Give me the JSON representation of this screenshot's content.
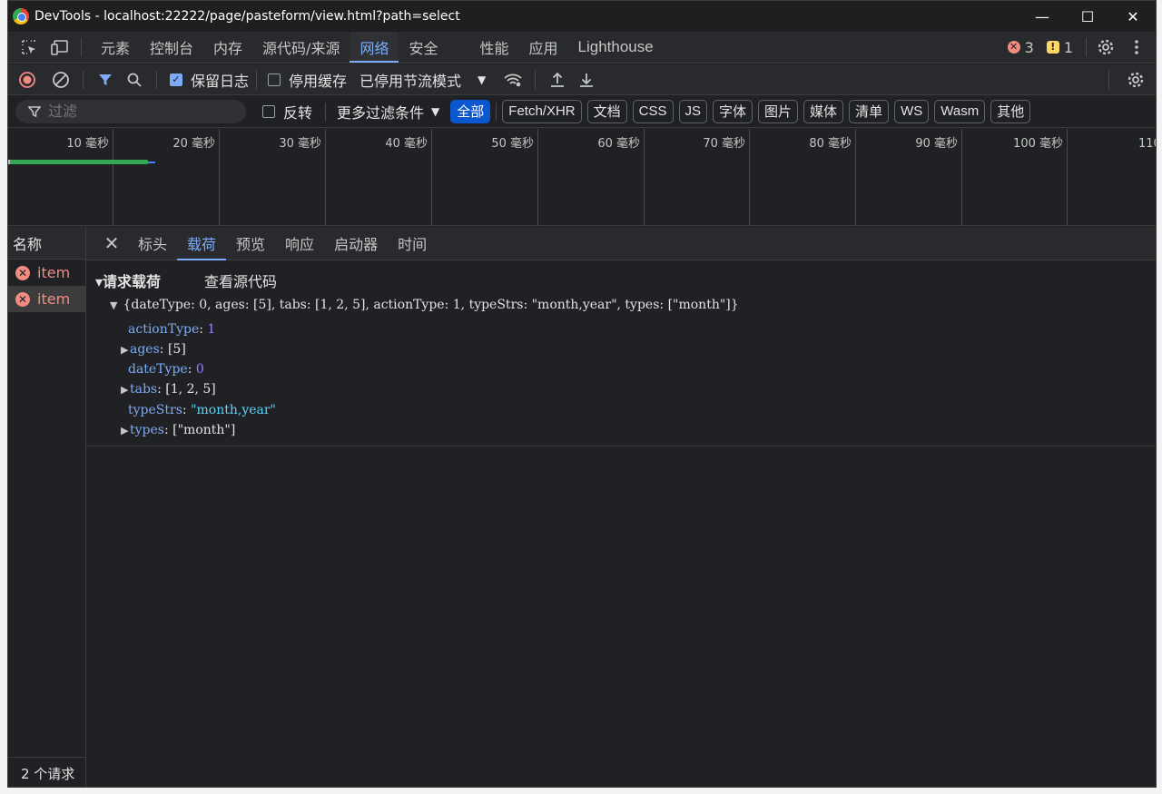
{
  "window": {
    "title": "DevTools - localhost:22222/page/pasteform/view.html?path=select",
    "minimize": "—",
    "maximize": "☐",
    "close": "✕"
  },
  "main_tabs": [
    "元素",
    "控制台",
    "内存",
    "源代码/来源",
    "网络",
    "安全",
    "性能",
    "应用",
    "Lighthouse"
  ],
  "active_main_tab": "网络",
  "issues": {
    "errors": "3",
    "warnings": "1"
  },
  "network_toolbar": {
    "preserve_log": "保留日志",
    "preserve_log_checked": true,
    "disable_cache": "停用缓存",
    "disable_cache_checked": false,
    "throttling": "已停用节流模式"
  },
  "filter": {
    "placeholder": "过滤",
    "invert": "反转",
    "more_filters": "更多过滤条件",
    "types": [
      "全部",
      "Fetch/XHR",
      "文档",
      "CSS",
      "JS",
      "字体",
      "图片",
      "媒体",
      "清单",
      "WS",
      "Wasm",
      "其他"
    ],
    "active_type": "全部"
  },
  "timeline": {
    "ticks": [
      "10 毫秒",
      "20 毫秒",
      "30 毫秒",
      "40 毫秒",
      "50 毫秒",
      "60 毫秒",
      "70 毫秒",
      "80 毫秒",
      "90 毫秒",
      "100 毫秒",
      "110 毫"
    ]
  },
  "request_list": {
    "header": "名称",
    "rows": [
      {
        "name": "item",
        "status": "error"
      },
      {
        "name": "item",
        "status": "error",
        "selected": true
      }
    ],
    "summary": "2 个请求"
  },
  "detail": {
    "tabs": [
      "标头",
      "载荷",
      "预览",
      "响应",
      "启动器",
      "时间"
    ],
    "active_tab": "载荷",
    "section_title": "▾请求载荷",
    "view_source": "查看源代码",
    "summary": "{dateType: 0, ages: [5], tabs: [1, 2, 5], actionType: 1, typeStrs: \"month,year\", types: [\"month\"]}",
    "props": [
      {
        "key": "actionType",
        "value": "1",
        "kind": "num",
        "expandable": false
      },
      {
        "key": "ages",
        "value": "[5]",
        "kind": "plain",
        "expandable": true
      },
      {
        "key": "dateType",
        "value": "0",
        "kind": "num",
        "expandable": false
      },
      {
        "key": "tabs",
        "value": "[1, 2, 5]",
        "kind": "plain",
        "expandable": true
      },
      {
        "key": "typeStrs",
        "value": "\"month,year\"",
        "kind": "str",
        "expandable": false
      },
      {
        "key": "types",
        "value": "[\"month\"]",
        "kind": "plain",
        "expandable": true
      }
    ]
  },
  "colors": {
    "accent": "#7cacf8",
    "error": "#f28b82",
    "bar_green": "#34a853",
    "background": "#202124"
  }
}
